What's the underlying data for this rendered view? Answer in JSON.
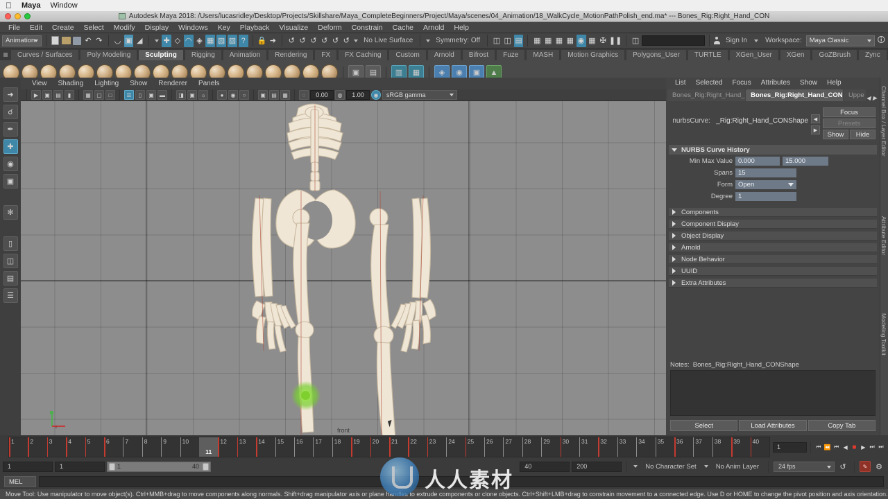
{
  "os_menu": {
    "apple_icon": "apple-icon",
    "app_name": "Maya",
    "items": [
      "Window"
    ]
  },
  "window": {
    "title": "Autodesk Maya 2018: /Users/lucasridley/Desktop/Projects/Skillshare/Maya_CompleteBeginners/Project/Maya/scenes/04_Animation/18_WalkCycle_MotionPathPolish_end.ma*   ---   Bones_Rig:Right_Hand_CON",
    "traffic": [
      "close",
      "minimize",
      "zoom"
    ]
  },
  "main_menu": {
    "items": [
      "File",
      "Edit",
      "Create",
      "Select",
      "Modify",
      "Display",
      "Windows",
      "Key",
      "Playback",
      "Visualize",
      "Deform",
      "Constrain",
      "Cache",
      "Arnold",
      "Help"
    ]
  },
  "status_line": {
    "menu_set": "Animation",
    "live_surface": "No Live Surface",
    "symmetry": "Symmetry: Off",
    "sign_in": "Sign In",
    "workspace_label": "Workspace:",
    "workspace_value": "Maya Classic"
  },
  "shelf": {
    "tabs": [
      "Curves / Surfaces",
      "Poly Modeling",
      "Sculpting",
      "Rigging",
      "Animation",
      "Rendering",
      "FX",
      "FX Caching",
      "Custom",
      "Arnold",
      "Bifrost",
      "Fuze",
      "MASH",
      "Motion Graphics",
      "Polygons_User",
      "TURTLE",
      "XGen_User",
      "XGen",
      "GoZBrush",
      "Zync"
    ],
    "active_tab": "Sculpting"
  },
  "viewport": {
    "menu": [
      "View",
      "Shading",
      "Lighting",
      "Show",
      "Renderer",
      "Panels"
    ],
    "exposure": "0.00",
    "gamma": "1.00",
    "color_space": "sRGB gamma",
    "label": "front",
    "axis_labels": {
      "y": "y",
      "x": "x",
      "z": "z"
    }
  },
  "attribute_editor": {
    "menu": [
      "List",
      "Selected",
      "Focus",
      "Attributes",
      "Show",
      "Help"
    ],
    "tabs": [
      {
        "label": "Bones_Rig:Right_Hand_CON",
        "active": false
      },
      {
        "label": "Bones_Rig:Right_Hand_CONShape",
        "active": true
      },
      {
        "label": "Uppe",
        "active": false
      }
    ],
    "node_type_label": "nurbsCurve:",
    "node_name": "_Rig:Right_Hand_CONShape",
    "focus_button": "Focus",
    "presets_button": "Presets",
    "show_button": "Show",
    "hide_button": "Hide",
    "section_title": "NURBS Curve History",
    "attributes": [
      {
        "label": "Min Max Value",
        "value": "0.000",
        "value2": "15.000",
        "type": "double"
      },
      {
        "label": "Spans",
        "value": "15",
        "type": "field"
      },
      {
        "label": "Form",
        "value": "Open",
        "type": "dropdown"
      },
      {
        "label": "Degree",
        "value": "1",
        "type": "field"
      }
    ],
    "collapsed_sections": [
      "Components",
      "Component Display",
      "Object Display",
      "Arnold",
      "Node Behavior",
      "UUID",
      "Extra Attributes"
    ],
    "notes_label": "Notes:",
    "notes_target": "Bones_Rig:Right_Hand_CONShape",
    "buttons": [
      "Select",
      "Load Attributes",
      "Copy Tab"
    ],
    "rail_labels": [
      "Channel Box / Layer Editor",
      "Attribute Editor",
      "Modeling Toolkit"
    ]
  },
  "timeline": {
    "frames": [
      1,
      2,
      3,
      4,
      5,
      6,
      7,
      8,
      9,
      10,
      11,
      12,
      13,
      14,
      15,
      16,
      17,
      18,
      19,
      20,
      21,
      22,
      23,
      24,
      25,
      26,
      27,
      28,
      29,
      30,
      31,
      32,
      33,
      34,
      35,
      36,
      37,
      38,
      39,
      40
    ],
    "keyframes": [
      1,
      2,
      3,
      4,
      5,
      6,
      11,
      12,
      13,
      14,
      19,
      20,
      21,
      22,
      23,
      25,
      30,
      32,
      36,
      39,
      40
    ],
    "current_frame": "11",
    "current_frame_field": "1",
    "playback_buttons": [
      "go-to-start",
      "step-back-keyframe",
      "step-back-frame",
      "play-backwards",
      "stop",
      "play-forwards",
      "step-forward-frame",
      "step-forward-keyframe"
    ]
  },
  "range": {
    "anim_start": "1",
    "range_start": "1",
    "slider_min": "1",
    "slider_max": "40",
    "range_end": "40",
    "anim_end": "200",
    "character_set": "No Character Set",
    "anim_layer": "No Anim Layer",
    "fps": "24 fps"
  },
  "command_line": {
    "tag": "MEL",
    "value": ""
  },
  "help_line": {
    "text": "Move Tool: Use manipulator to move object(s). Ctrl+MMB+drag to move components along normals. Shift+drag manipulator axis or plane handles to extrude components or clone objects. Ctrl+Shift+LMB+drag to constrain movement to a connected edge. Use D or HOME to change the pivot position and axis orientation."
  },
  "colors": {
    "accent_blue": "#3f87a8",
    "field_blue": "#6f7a88",
    "panel_bg": "#444444",
    "viewport_bg": "#8d8d8d",
    "keyframe_red": "#c43b30"
  }
}
